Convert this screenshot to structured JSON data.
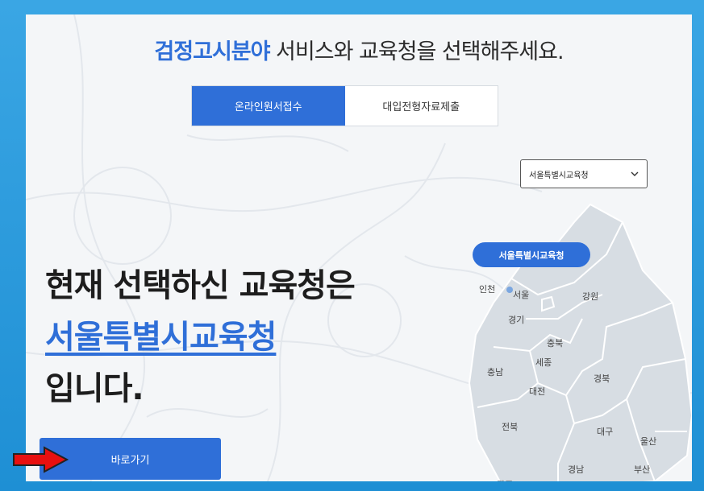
{
  "headline": {
    "accent": "검정고시분야",
    "rest": " 서비스와 교육청을 선택해주세요."
  },
  "tabs": [
    {
      "label": "온라인원서접수",
      "active": true
    },
    {
      "label": "대입전형자료제출",
      "active": false
    }
  ],
  "office_select": {
    "value": "서울특별시교육청"
  },
  "main": {
    "line1": "현재 선택하신 교육청은",
    "selected": "서울특별시교육청",
    "line3": "입니다."
  },
  "go_button": {
    "label": "바로가기"
  },
  "map": {
    "pin_label": "서울특별시교육청",
    "regions": [
      "인천",
      "서울",
      "강원",
      "경기",
      "충북",
      "세종",
      "충남",
      "대전",
      "경북",
      "전북",
      "대구",
      "울산",
      "경남",
      "부산",
      "광주"
    ]
  },
  "colors": {
    "accent": "#2f6fd8",
    "arrow": "#e81010"
  }
}
